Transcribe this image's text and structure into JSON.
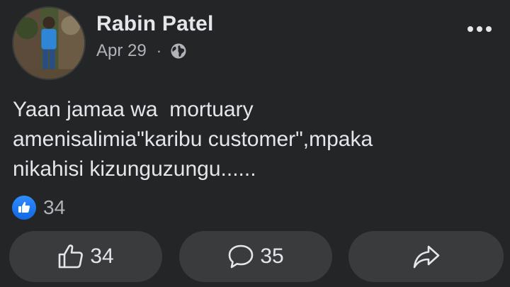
{
  "post": {
    "author": "Rabin Patel",
    "date": "Apr 29",
    "separator": "·",
    "audience_icon": "globe-icon",
    "text": "Yaan jamaa wa  mortuary\namenisalimia\"karibu customer\",mpaka\nnikahisi kizunguzungu......",
    "reaction_count": "34"
  },
  "actions": {
    "like_count": "34",
    "comment_count": "35"
  },
  "colors": {
    "background": "#242526",
    "button_bg": "#3a3b3c",
    "primary_text": "#e4e6eb",
    "secondary_text": "#b0b3b8",
    "like_blue": "#1877f2"
  }
}
